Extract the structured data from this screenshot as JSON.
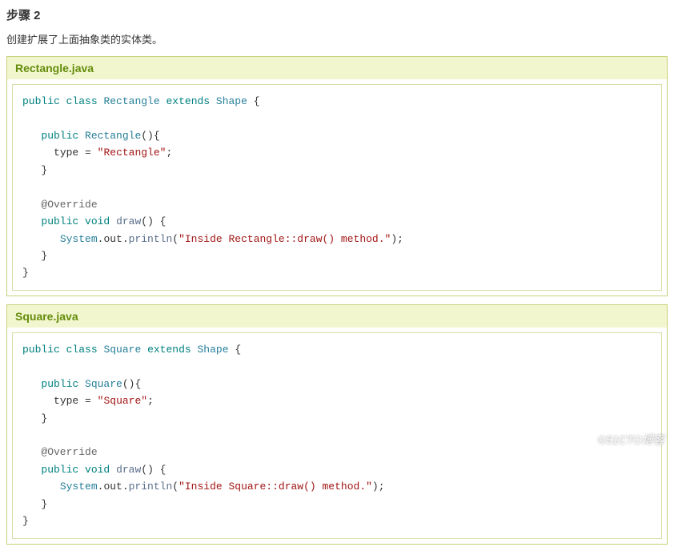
{
  "heading": "步骤 2",
  "description": "创建扩展了上面抽象类的实体类。",
  "files": [
    {
      "title": "Rectangle.java"
    },
    {
      "title": "Square.java"
    }
  ],
  "code": {
    "r": {
      "kw_public1": "public",
      "kw_class": "class",
      "cls_rect": "Rectangle",
      "kw_extends": "extends",
      "cls_shape": "Shape",
      "kw_public2": "public",
      "ctor": "Rectangle",
      "id_type1": "type",
      "str_type1": "\"Rectangle\"",
      "ann": "@Override",
      "kw_public3": "public",
      "kw_void": "void",
      "fn_draw": "draw",
      "id_sys": "System",
      "id_out": "out",
      "fn_println": "println",
      "str_msg": "\"Inside Rectangle::draw() method.\""
    },
    "s": {
      "kw_public1": "public",
      "kw_class": "class",
      "cls_sq": "Square",
      "kw_extends": "extends",
      "cls_shape": "Shape",
      "kw_public2": "public",
      "ctor": "Square",
      "id_type1": "type",
      "str_type1": "\"Square\"",
      "ann": "@Override",
      "kw_public3": "public",
      "kw_void": "void",
      "fn_draw": "draw",
      "id_sys": "System",
      "id_out": "out",
      "fn_println": "println",
      "str_msg": "\"Inside Square::draw() method.\""
    }
  },
  "watermark": "©51CTO博客"
}
